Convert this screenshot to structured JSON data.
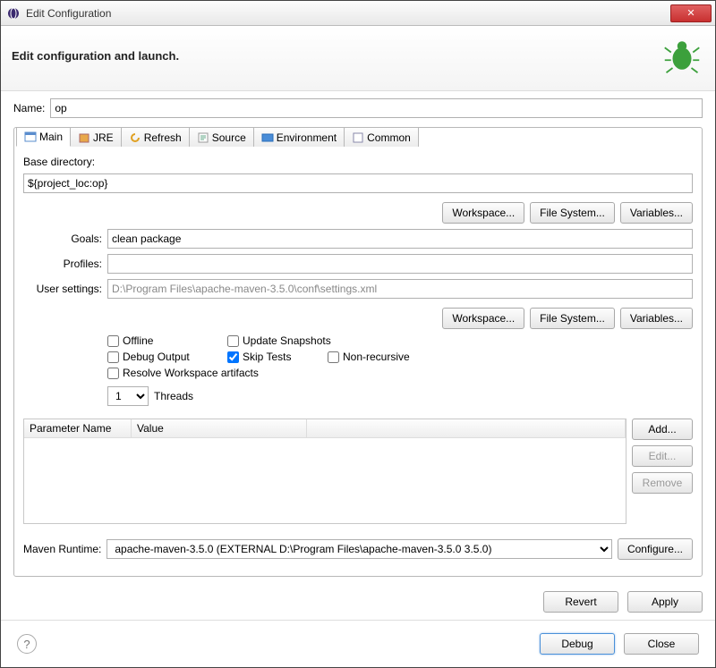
{
  "window": {
    "title": "Edit Configuration"
  },
  "subheader": {
    "title": "Edit configuration and launch."
  },
  "nameRow": {
    "label": "Name:",
    "value": "op"
  },
  "tabs": [
    {
      "label": "Main"
    },
    {
      "label": "JRE"
    },
    {
      "label": "Refresh"
    },
    {
      "label": "Source"
    },
    {
      "label": "Environment"
    },
    {
      "label": "Common"
    }
  ],
  "main": {
    "baseDir": {
      "label": "Base directory:",
      "value": "${project_loc:op}"
    },
    "baseDirButtons": {
      "workspace": "Workspace...",
      "filesystem": "File System...",
      "variables": "Variables..."
    },
    "goals": {
      "label": "Goals:",
      "value": "clean package"
    },
    "profiles": {
      "label": "Profiles:",
      "value": ""
    },
    "userSettings": {
      "label": "User settings:",
      "value": "D:\\Program Files\\apache-maven-3.5.0\\conf\\settings.xml"
    },
    "usButtons": {
      "workspace": "Workspace...",
      "filesystem": "File System...",
      "variables": "Variables..."
    },
    "checks": {
      "offline": "Offline",
      "updateSnapshots": "Update Snapshots",
      "debugOutput": "Debug Output",
      "skipTests": "Skip Tests",
      "nonRecursive": "Non-recursive",
      "resolveWs": "Resolve Workspace artifacts"
    },
    "threads": {
      "value": "1",
      "label": "Threads"
    },
    "paramTable": {
      "col1": "Parameter Name",
      "col2": "Value",
      "add": "Add...",
      "edit": "Edit...",
      "remove": "Remove"
    },
    "runtime": {
      "label": "Maven Runtime:",
      "value": "apache-maven-3.5.0 (EXTERNAL D:\\Program Files\\apache-maven-3.5.0 3.5.0)",
      "configure": "Configure..."
    }
  },
  "bottom": {
    "revert": "Revert",
    "apply": "Apply"
  },
  "footer": {
    "debug": "Debug",
    "close": "Close"
  }
}
